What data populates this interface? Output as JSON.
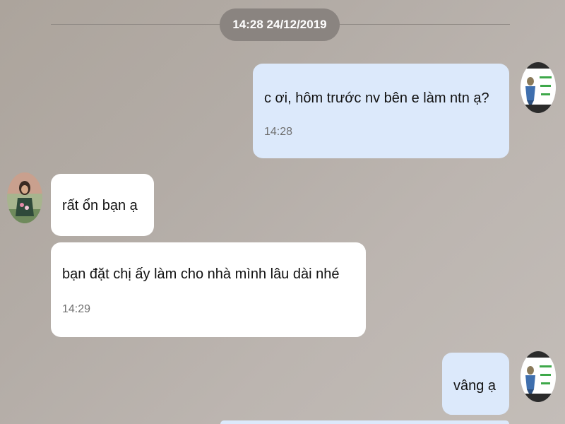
{
  "chat": {
    "date_divider": "14:28 24/12/2019",
    "messages": [
      {
        "sender": "self",
        "text": "c ơi, hôm trước nv bên e làm ntn ạ?",
        "time": "14:28"
      },
      {
        "sender": "other",
        "text": "rất ổn bạn ạ",
        "time": ""
      },
      {
        "sender": "other",
        "text": "bạn đặt chị ấy làm cho nhà mình lâu dài nhé",
        "time": "14:29"
      },
      {
        "sender": "self",
        "text": "vâng ạ",
        "time": ""
      }
    ]
  },
  "avatars": {
    "self_icon": "company-logo-avatar-icon",
    "other_icon": "user-photo-avatar-icon"
  },
  "colors": {
    "outgoing_bubble": "#dce9fb",
    "incoming_bubble": "#ffffff",
    "date_pill": "#8a8480",
    "background": "#b3aca6"
  }
}
